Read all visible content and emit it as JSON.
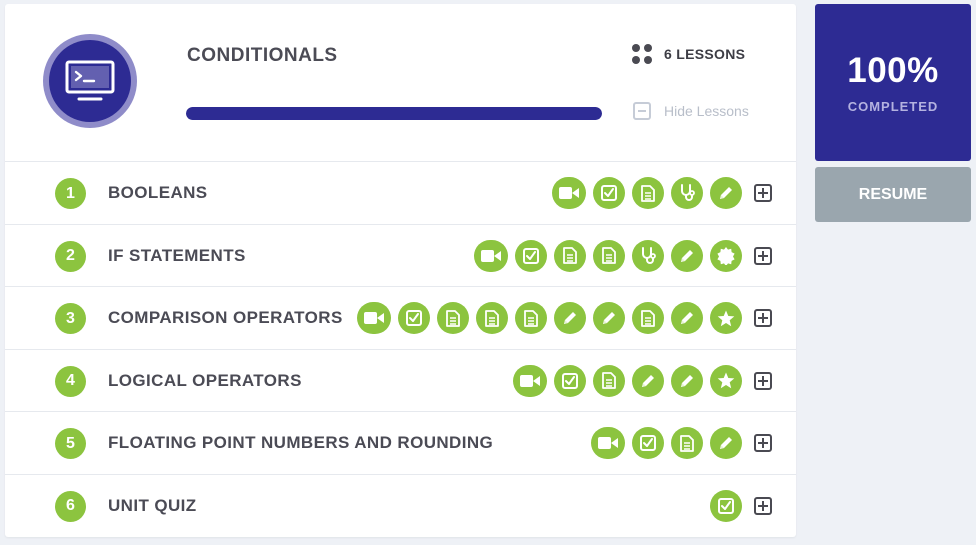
{
  "unit": {
    "title": "CONDITIONALS",
    "icon": "terminal-monitor-icon",
    "lesson_count": "6 LESSONS",
    "hide_lessons": "Hide Lessons",
    "progress_fraction": 1.0,
    "accent_color": "#2d2b93",
    "success_color": "#8cc43f"
  },
  "completion": {
    "percent": "100%",
    "label": "COMPLETED",
    "resume": "RESUME"
  },
  "lessons": [
    {
      "number": "1",
      "title": "BOOLEANS",
      "activities": [
        "video",
        "check",
        "doc",
        "stethoscope",
        "pencil"
      ]
    },
    {
      "number": "2",
      "title": "IF STATEMENTS",
      "activities": [
        "video",
        "check",
        "doc",
        "doc",
        "stethoscope",
        "pencil",
        "badge"
      ]
    },
    {
      "number": "3",
      "title": "COMPARISON OPERATORS",
      "activities": [
        "video",
        "check",
        "doc",
        "doc",
        "doc",
        "pencil",
        "pencil",
        "doc",
        "pencil",
        "star"
      ]
    },
    {
      "number": "4",
      "title": "LOGICAL OPERATORS",
      "activities": [
        "video",
        "check",
        "doc",
        "pencil",
        "pencil",
        "star"
      ]
    },
    {
      "number": "5",
      "title": "FLOATING POINT NUMBERS AND ROUNDING",
      "activities": [
        "video",
        "check",
        "doc",
        "pencil"
      ]
    },
    {
      "number": "6",
      "title": "UNIT QUIZ",
      "activities": [
        "check"
      ]
    }
  ]
}
